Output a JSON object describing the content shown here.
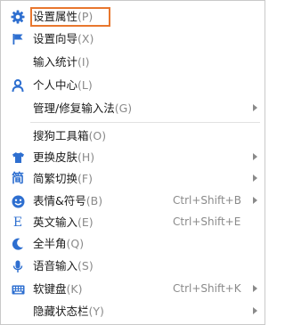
{
  "colors": {
    "icon_blue": "#2e6fd0",
    "highlight": "#e8772e",
    "text": "#1a1a1a",
    "hint": "#8a8a8a"
  },
  "menu": {
    "items": [
      {
        "label": "设置属性",
        "key": "(P)",
        "icon": "gear-icon",
        "shortcut": "",
        "submenu": false,
        "highlighted": true
      },
      {
        "label": "设置向导",
        "key": "(X)",
        "icon": "flag-icon",
        "shortcut": "",
        "submenu": false
      },
      {
        "label": "输入统计",
        "key": "(I)",
        "icon": "",
        "shortcut": "",
        "submenu": false
      },
      {
        "label": "个人中心",
        "key": "(L)",
        "icon": "user-icon",
        "shortcut": "",
        "submenu": false
      },
      {
        "label": "管理/修复输入法",
        "key": "(G)",
        "icon": "",
        "shortcut": "",
        "submenu": true
      },
      {
        "label": "搜狗工具箱",
        "key": "(O)",
        "icon": "",
        "shortcut": "",
        "submenu": false
      },
      {
        "label": "更换皮肤",
        "key": "(H)",
        "icon": "shirt-icon",
        "shortcut": "",
        "submenu": true
      },
      {
        "label": "简繁切换",
        "key": "(F)",
        "icon": "jian-icon",
        "icon_text": "简",
        "shortcut": "",
        "submenu": true
      },
      {
        "label": "表情&符号",
        "key": "(B)",
        "icon": "smiley-icon",
        "shortcut": "Ctrl+Shift+B",
        "submenu": true
      },
      {
        "label": "英文输入",
        "key": "(E)",
        "icon": "english-e-icon",
        "icon_text": "E",
        "shortcut": "Ctrl+Shift+E",
        "submenu": false
      },
      {
        "label": "全半角",
        "key": "(Q)",
        "icon": "moon-icon",
        "shortcut": "",
        "submenu": false
      },
      {
        "label": "语音输入",
        "key": "(S)",
        "icon": "microphone-icon",
        "shortcut": "",
        "submenu": false
      },
      {
        "label": "软键盘",
        "key": "(K)",
        "icon": "keyboard-icon",
        "shortcut": "Ctrl+Shift+K",
        "submenu": true
      },
      {
        "label": "隐藏状态栏",
        "key": "(Y)",
        "icon": "",
        "shortcut": "",
        "submenu": true
      }
    ]
  }
}
